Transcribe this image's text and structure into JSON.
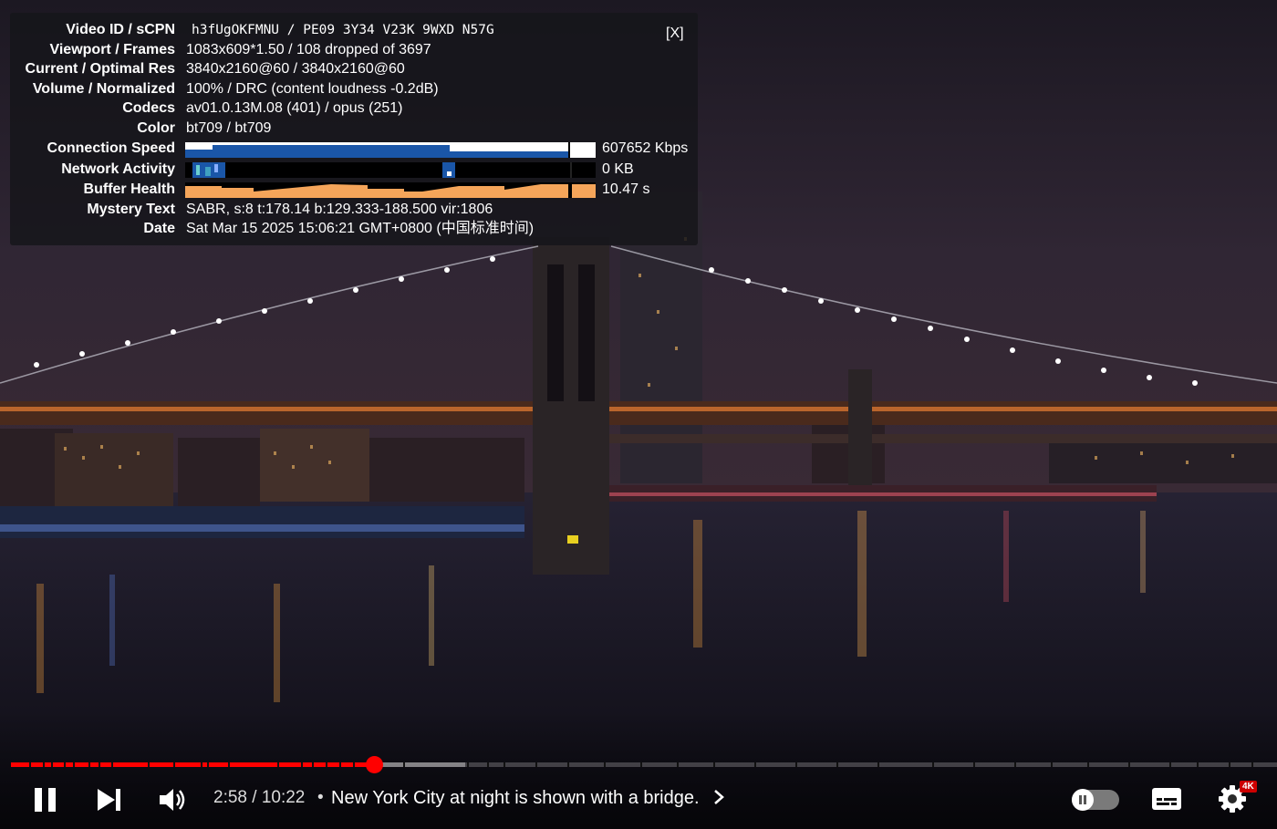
{
  "stats": {
    "close_label": "[X]",
    "rows": [
      {
        "label": "Video ID / sCPN",
        "value": "h3fUgOKFMNU / PE09 3Y34 V23K 9WXD N57G"
      },
      {
        "label": "Viewport / Frames",
        "value": "1083x609*1.50 / 108 dropped of 3697"
      },
      {
        "label": "Current / Optimal Res",
        "value": "3840x2160@60 / 3840x2160@60"
      },
      {
        "label": "Volume / Normalized",
        "value": "100% / DRC (content loudness -0.2dB)"
      },
      {
        "label": "Codecs",
        "value": "av01.0.13M.08 (401) / opus (251)"
      },
      {
        "label": "Color",
        "value": "bt709 / bt709"
      },
      {
        "label": "Connection Speed",
        "value": "607652 Kbps"
      },
      {
        "label": "Network Activity",
        "value": "0 KB"
      },
      {
        "label": "Buffer Health",
        "value": "10.47 s"
      },
      {
        "label": "Mystery Text",
        "value": "SABR, s:8 t:178.14 b:129.333-188.500 vir:1806"
      },
      {
        "label": "Date",
        "value": "Sat Mar 15 2025 15:06:21 GMT+0800 (中国标准时间)"
      }
    ],
    "graph_colors": {
      "connection": "#1a56a8",
      "network": "#1a56a8",
      "buffer": "#f5a55a"
    }
  },
  "player": {
    "time_display": "2:58 / 10:22",
    "separator": "•",
    "chapter_title": "New York City at night is shown with a bridge.",
    "progress_played_fraction": 0.2868,
    "progress_buffered_fraction": 0.3585,
    "quality_badge": "4K",
    "accent_color": "#ff0000",
    "icons": [
      "pause-icon",
      "next-icon",
      "volume-icon",
      "chevron-right-icon",
      "autoplay-toggle-icon",
      "subtitles-icon",
      "settings-gear-icon"
    ]
  }
}
